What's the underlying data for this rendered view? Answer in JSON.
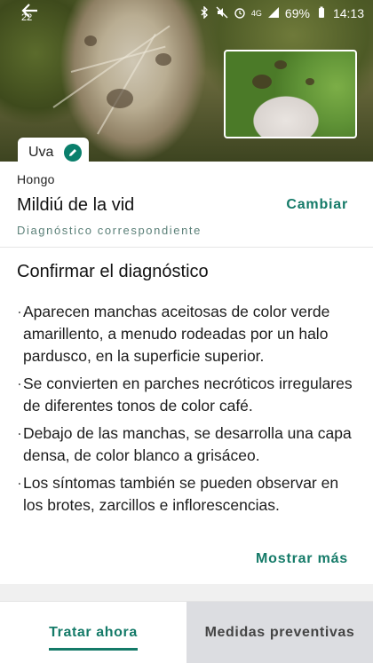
{
  "status_bar": {
    "left_number": "22",
    "battery_text": "69%",
    "time": "14:13",
    "network": "4G"
  },
  "crop": {
    "label": "Uva"
  },
  "diagnosis": {
    "category": "Hongo",
    "name": "Mildiú de la vid",
    "subtitle": "Diagnóstico correspondiente",
    "change_label": "Cambiar"
  },
  "confirm": {
    "heading": "Confirmar el diagnóstico",
    "bullets": [
      "Aparecen manchas aceitosas de color verde amarillento, a menudo rodeadas por un halo pardusco, en la superficie superior.",
      "Se convierten en parches necróticos irregulares de diferentes tonos de color café.",
      "Debajo de las manchas, se desarrolla una capa densa, de color blanco a grisáceo.",
      "Los síntomas también se pueden observar en los brotes, zarcillos e inflorescencias."
    ],
    "more_label": "Mostrar más"
  },
  "tabs": [
    {
      "label": "Tratar ahora",
      "active": true
    },
    {
      "label": "Medidas preventivas",
      "active": false
    }
  ],
  "colors": {
    "accent": "#147a68",
    "edit_button": "#0a7f6c"
  },
  "icons": [
    "back-arrow-icon",
    "pencil-icon",
    "bluetooth-icon",
    "mute-icon",
    "alarm-icon",
    "signal-icon",
    "battery-icon"
  ]
}
